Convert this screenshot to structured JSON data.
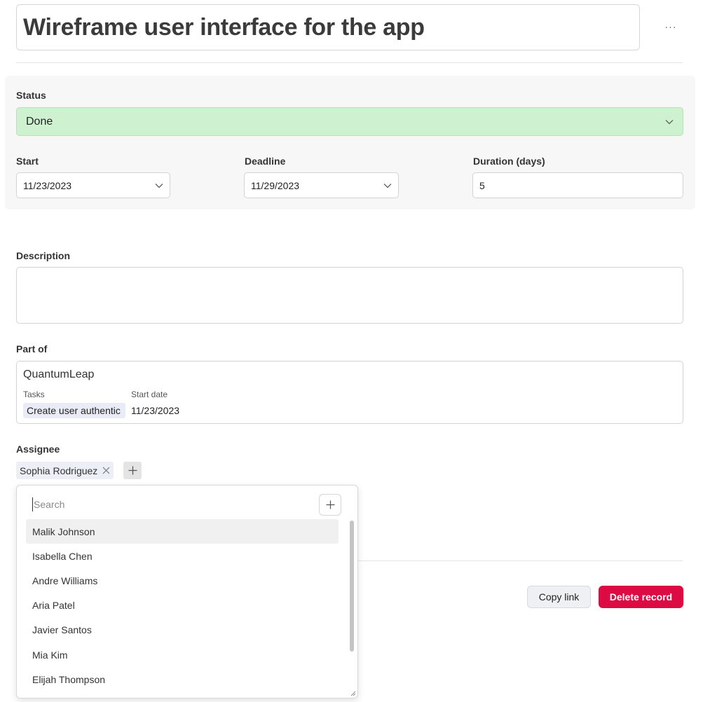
{
  "record": {
    "title": "Wireframe user interface for the app",
    "more_label": "···"
  },
  "status": {
    "label": "Status",
    "value": "Done",
    "color": "#cef2d0"
  },
  "dates": {
    "start_label": "Start",
    "start_value": "11/23/2023",
    "deadline_label": "Deadline",
    "deadline_value": "11/29/2023",
    "duration_label": "Duration (days)",
    "duration_value": "5"
  },
  "description": {
    "label": "Description",
    "value": ""
  },
  "part_of": {
    "label": "Part of",
    "name": "QuantumLeap",
    "tasks_label": "Tasks",
    "task_chip": "Create user authentic",
    "start_date_label": "Start date",
    "start_date_value": "11/23/2023"
  },
  "assignee": {
    "label": "Assignee",
    "selected": "Sophia Rodriguez"
  },
  "dropdown": {
    "search_placeholder": "Search",
    "items": [
      "Malik Johnson",
      "Isabella Chen",
      "Andre Williams",
      "Aria Patel",
      "Javier Santos",
      "Mia Kim",
      "Elijah Thompson"
    ],
    "highlighted_item": "Malik Johnson"
  },
  "actions": {
    "copy_link": "Copy link",
    "delete_record": "Delete record",
    "delete_color": "#dc0b43"
  }
}
